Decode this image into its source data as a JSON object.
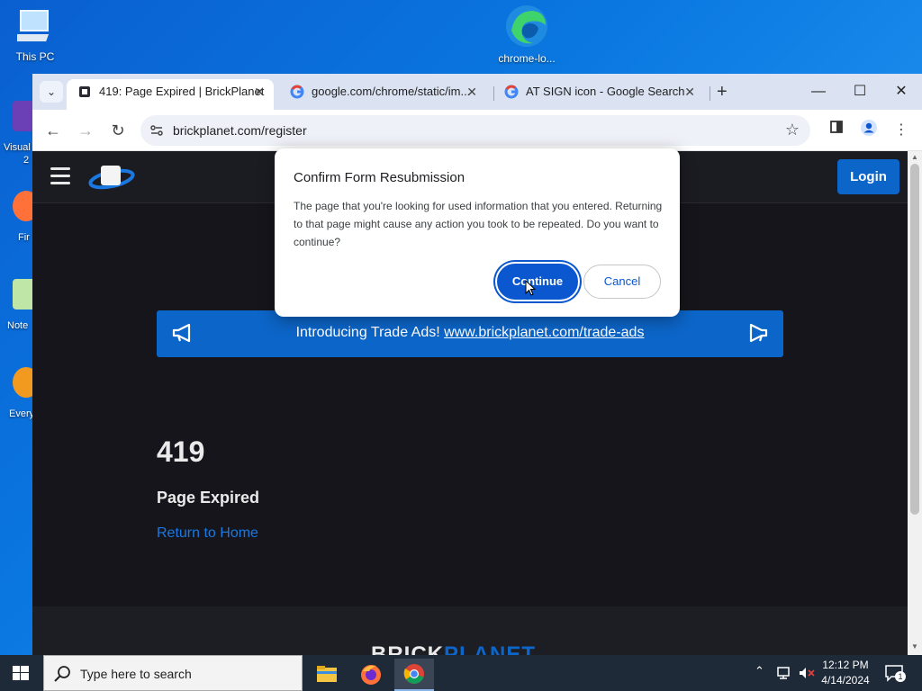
{
  "desktop": {
    "icons": [
      {
        "label": "This PC"
      },
      {
        "label": "chrome-lo..."
      }
    ],
    "edge_labels": [
      "Visual",
      "2",
      "Fir",
      "Note",
      "Every"
    ]
  },
  "browser": {
    "tabs": [
      {
        "title": "419: Page Expired | BrickPlanet",
        "active": true
      },
      {
        "title": "google.com/chrome/static/im...",
        "active": false
      },
      {
        "title": "AT SIGN icon - Google Search",
        "active": false
      }
    ],
    "url": "brickplanet.com/register"
  },
  "page": {
    "login_label": "Login",
    "announcement_prefix": "Introducing Trade Ads!",
    "announcement_link": "www.brickplanet.com/trade-ads",
    "error_code": "419",
    "error_message": "Page Expired",
    "home_link": "Return to Home",
    "footer_brand_a": "BRICK",
    "footer_brand_b": "PLANET"
  },
  "dialog": {
    "title": "Confirm Form Resubmission",
    "body": "The page that you're looking for used information that you entered. Returning to that page might cause any action you took to be repeated. Do you want to continue?",
    "continue_label": "Continue",
    "cancel_label": "Cancel"
  },
  "taskbar": {
    "search_placeholder": "Type here to search",
    "time": "12:12 PM",
    "date": "4/14/2024",
    "notification_count": "1"
  },
  "colors": {
    "brand_blue": "#0c65c8",
    "dialog_blue": "#0b57d0",
    "page_bg": "#15151b"
  }
}
